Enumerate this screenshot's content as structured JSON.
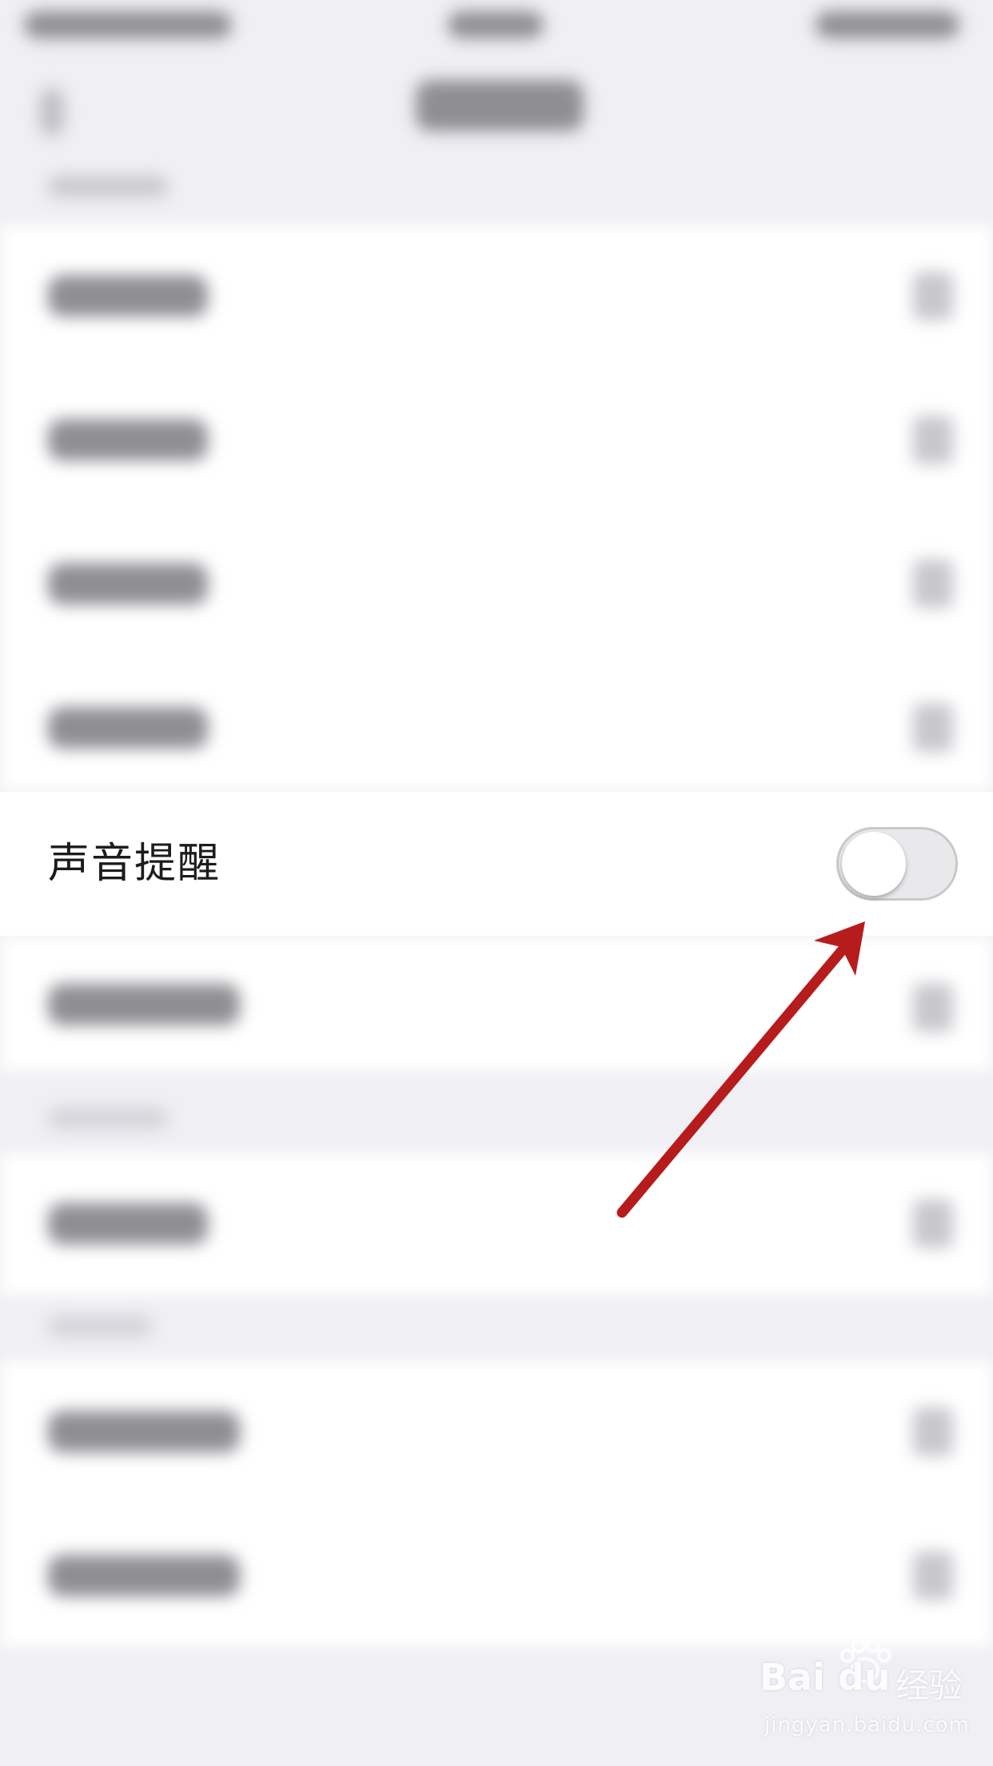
{
  "settings": {
    "sound_reminder_label": "声音提醒",
    "sound_reminder_enabled": false
  },
  "watermark": {
    "brand_text": "Bai du",
    "product_text": "经验",
    "url_text": "jingyan.baidu.com"
  },
  "colors": {
    "annotation_arrow": "#b71c1c",
    "toggle_off_track": "#e9e9eb"
  }
}
